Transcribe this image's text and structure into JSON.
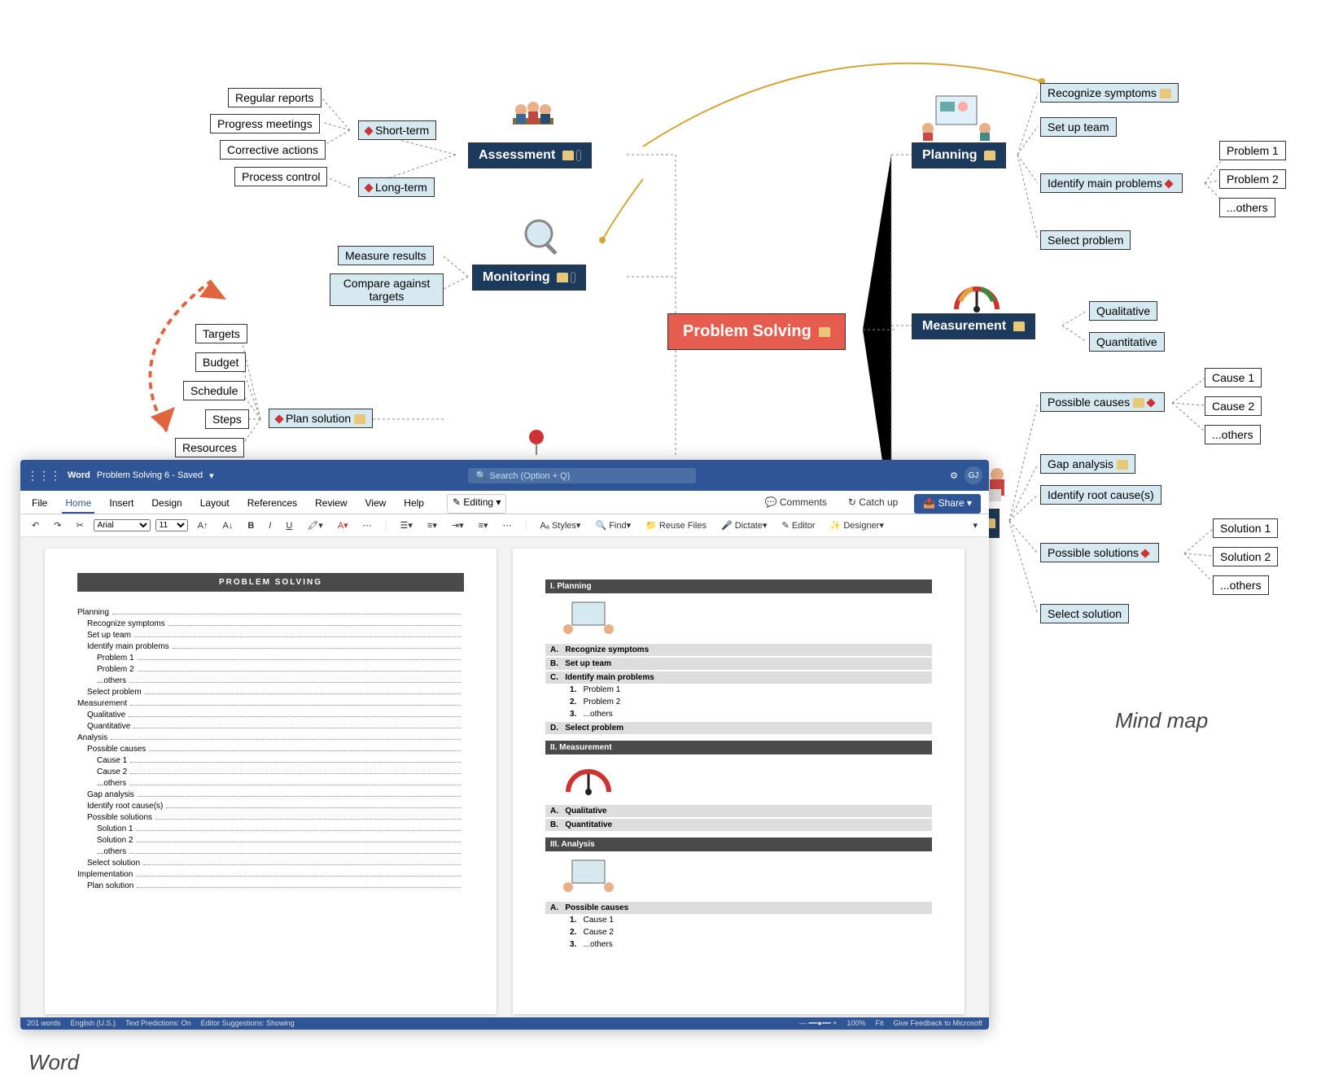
{
  "mindmap": {
    "central": "Problem Solving",
    "branches": {
      "assessment": {
        "label": "Assessment",
        "children": {
          "shortterm": {
            "label": "Short-term",
            "sub": [
              "Regular reports",
              "Progress meetings",
              "Corrective actions"
            ]
          },
          "longterm": {
            "label": "Long-term",
            "sub": [
              "Process control"
            ]
          }
        }
      },
      "monitoring": {
        "label": "Monitoring",
        "children": {
          "measure": "Measure results",
          "compare": "Compare against\ntargets"
        }
      },
      "implementation_sub": {
        "plan": {
          "label": "Plan solution",
          "sub": [
            "Targets",
            "Budget",
            "Schedule",
            "Steps",
            "Resources"
          ]
        }
      },
      "planning": {
        "label": "Planning",
        "children": {
          "recognize": "Recognize symptoms",
          "setup": "Set up team",
          "identify": {
            "label": "Identify main problems",
            "sub": [
              "Problem 1",
              "Problem 2",
              "...others"
            ]
          },
          "select": "Select problem"
        }
      },
      "measurement": {
        "label": "Measurement",
        "children": {
          "qual": "Qualitative",
          "quant": "Quantitative"
        }
      },
      "analysis": {
        "children": {
          "possible_causes": {
            "label": "Possible causes",
            "sub": [
              "Cause 1",
              "Cause 2",
              "...others"
            ]
          },
          "gap": "Gap analysis",
          "root": "Identify root cause(s)",
          "possible_solutions": {
            "label": "Possible solutions",
            "sub": [
              "Solution 1",
              "Solution 2",
              "...others"
            ]
          },
          "select_sol": "Select solution"
        }
      }
    }
  },
  "word": {
    "app": "Word",
    "doc_name": "Problem Solving 6 - Saved",
    "search_placeholder": "Search (Option + Q)",
    "tabs": [
      "File",
      "Home",
      "Insert",
      "Design",
      "Layout",
      "References",
      "Review",
      "View",
      "Help"
    ],
    "editing_btn": "Editing",
    "comments_btn": "Comments",
    "catchup_btn": "Catch up",
    "share_btn": "Share",
    "font": "Arial",
    "font_size": "11",
    "toolbar": {
      "styles": "Styles",
      "find": "Find",
      "reuse": "Reuse Files",
      "dictate": "Dictate",
      "editor": "Editor",
      "designer": "Designer"
    },
    "doc_title": "PROBLEM SOLVING",
    "toc": [
      {
        "t": "Planning",
        "l": 0
      },
      {
        "t": "Recognize symptoms",
        "l": 1
      },
      {
        "t": "Set up team",
        "l": 1
      },
      {
        "t": "Identify main problems",
        "l": 1
      },
      {
        "t": "Problem 1",
        "l": 2
      },
      {
        "t": "Problem 2",
        "l": 2
      },
      {
        "t": "...others",
        "l": 2
      },
      {
        "t": "Select problem",
        "l": 1
      },
      {
        "t": "Measurement",
        "l": 0
      },
      {
        "t": "Qualitative",
        "l": 1
      },
      {
        "t": "Quantitative",
        "l": 1
      },
      {
        "t": "Analysis",
        "l": 0
      },
      {
        "t": "Possible causes",
        "l": 1
      },
      {
        "t": "Cause 1",
        "l": 2
      },
      {
        "t": "Cause 2",
        "l": 2
      },
      {
        "t": "...others",
        "l": 2
      },
      {
        "t": "Gap analysis",
        "l": 1
      },
      {
        "t": "Identify root cause(s)",
        "l": 1
      },
      {
        "t": "Possible solutions",
        "l": 1
      },
      {
        "t": "Solution 1",
        "l": 2
      },
      {
        "t": "Solution 2",
        "l": 2
      },
      {
        "t": "...others",
        "l": 2
      },
      {
        "t": "Select solution",
        "l": 1
      },
      {
        "t": "Implementation",
        "l": 0
      },
      {
        "t": "Plan solution",
        "l": 1
      }
    ],
    "page2": {
      "sections": [
        {
          "num": "I.",
          "title": "Planning",
          "items": [
            {
              "l": "A.",
              "t": "Recognize symptoms"
            },
            {
              "l": "B.",
              "t": "Set up team"
            },
            {
              "l": "C.",
              "t": "Identify main problems"
            },
            {
              "l": "1.",
              "t": "Problem 1",
              "sub": true
            },
            {
              "l": "2.",
              "t": "Problem 2",
              "sub": true
            },
            {
              "l": "3.",
              "t": "...others",
              "sub": true
            },
            {
              "l": "D.",
              "t": "Select problem"
            }
          ]
        },
        {
          "num": "II.",
          "title": "Measurement",
          "items": [
            {
              "l": "A.",
              "t": "Qualitative"
            },
            {
              "l": "B.",
              "t": "Quantitative"
            }
          ]
        },
        {
          "num": "III.",
          "title": "Analysis",
          "items": [
            {
              "l": "A.",
              "t": "Possible causes"
            },
            {
              "l": "1.",
              "t": "Cause 1",
              "sub": true
            },
            {
              "l": "2.",
              "t": "Cause 2",
              "sub": true
            },
            {
              "l": "3.",
              "t": "...others",
              "sub": true
            }
          ]
        }
      ]
    },
    "status": {
      "words": "201 words",
      "lang": "English (U.S.)",
      "pred": "Text Predictions: On",
      "sugg": "Editor Suggestions: Showing",
      "zoom": "100%",
      "fit": "Fit",
      "feedback": "Give Feedback to Microsoft"
    }
  },
  "captions": {
    "word": "Word",
    "mindmap": "Mind map"
  }
}
